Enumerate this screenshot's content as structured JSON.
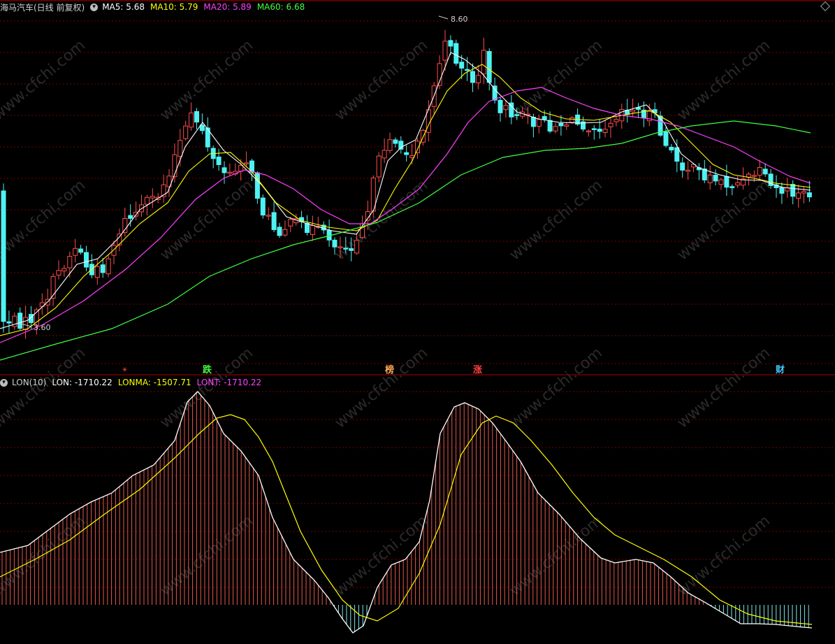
{
  "header": {
    "title": "海马汽车(日线 前复权)",
    "menu_icon": "chevron-down-icon",
    "ma": [
      {
        "label": "MA5: 5.68",
        "color": "#ffffff"
      },
      {
        "label": "MA10: 5.79",
        "color": "#ffff00"
      },
      {
        "label": "MA20: 5.89",
        "color": "#ff40ff"
      },
      {
        "label": "MA60: 6.68",
        "color": "#40ff40"
      }
    ]
  },
  "price_panel": {
    "high_label": "8.60",
    "low_label": "3.60",
    "events": [
      {
        "label": "☀",
        "color": "#ff4040"
      },
      {
        "label": "跌",
        "color": "#40ff40"
      },
      {
        "label": "榜",
        "color": "#ffaa55"
      },
      {
        "label": "涨",
        "color": "#ff4040"
      },
      {
        "label": "财",
        "color": "#40c8ff"
      }
    ]
  },
  "indicator": {
    "name": "LON(10)",
    "lines": [
      {
        "label": "LON: -1710.22",
        "color": "#ffffff"
      },
      {
        "label": "LONMA: -1507.71",
        "color": "#ffff00"
      },
      {
        "label": "LONT: -1710.22",
        "color": "#ff40ff"
      }
    ]
  },
  "watermark": "www.cfchi.com",
  "colors": {
    "up": "#ff4d4d",
    "down": "#4ff2f2",
    "grid": "#7a0000"
  },
  "chart_data": [
    {
      "type": "candlestick",
      "title": "海马汽车(日线 前复权)",
      "high": 8.6,
      "low": 3.6,
      "series": [
        {
          "name": "MA5",
          "last": 5.68
        },
        {
          "name": "MA10",
          "last": 5.79
        },
        {
          "name": "MA20",
          "last": 5.89
        },
        {
          "name": "MA60",
          "last": 6.68
        }
      ]
    },
    {
      "type": "bar",
      "title": "LON(10)",
      "series": [
        {
          "name": "LON",
          "last": -1710.22
        },
        {
          "name": "LONMA",
          "last": -1507.71
        },
        {
          "name": "LONT",
          "last": -1710.22
        }
      ]
    }
  ]
}
